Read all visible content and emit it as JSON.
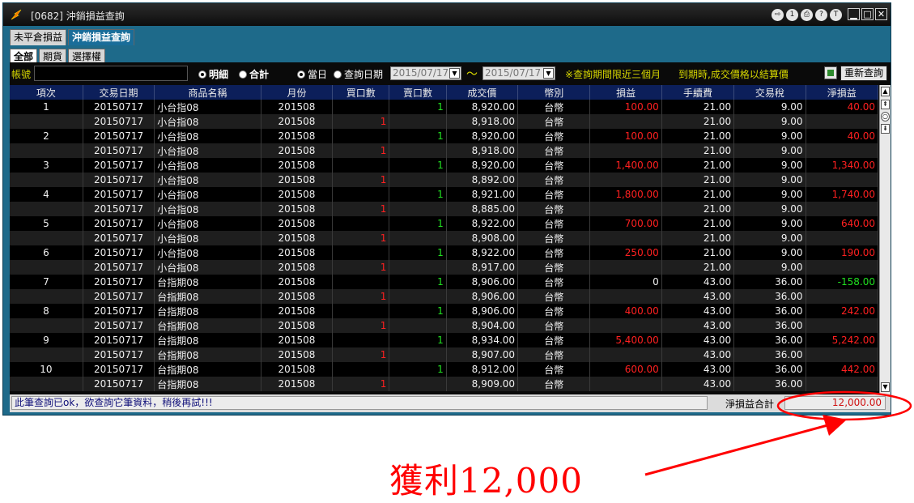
{
  "window": {
    "title": "[0682] 沖銷損益查詢",
    "toolbar_icons": [
      {
        "name": "exit-icon",
        "glyph": "⇨"
      },
      {
        "name": "info-icon",
        "glyph": "1"
      },
      {
        "name": "print-icon",
        "glyph": "⎙"
      },
      {
        "name": "help-icon",
        "glyph": "?"
      },
      {
        "name": "topmost-icon",
        "glyph": "T"
      }
    ],
    "minimize_glyph": "▁",
    "maximize_glyph": "□",
    "close_glyph": "✕"
  },
  "tabs_main": [
    {
      "label": "未平倉損益",
      "active": false
    },
    {
      "label": "沖銷損益查詢",
      "active": true
    }
  ],
  "tabs_sub": [
    {
      "label": "全部",
      "active": true
    },
    {
      "label": "期貨",
      "active": false
    },
    {
      "label": "選擇權",
      "active": false
    }
  ],
  "query": {
    "account_label": "帳號",
    "account_value": "",
    "detail_label": "明細",
    "sum_label": "合計",
    "today_label": "當日",
    "query_date_label": "查詢日期",
    "date_from": "2015/07/17",
    "tilde": "～",
    "date_to": "2015/07/17",
    "notice": "※查詢期間限近三個月",
    "notice2": "到期時,成交價格以結算價",
    "refresh_label": "重新查詢"
  },
  "table": {
    "columns": [
      "項次",
      "交易日期",
      "商品名稱",
      "月份",
      "買口數",
      "賣口數",
      "成交價",
      "幣別",
      "損益",
      "手續費",
      "交易稅",
      "淨損益"
    ],
    "rows": [
      [
        "1",
        "20150717",
        "小台指08",
        "201508",
        "",
        "1",
        "8,920.00",
        "台幣",
        "100.00",
        "21.00",
        "9.00",
        "40.00"
      ],
      [
        "",
        "20150717",
        "小台指08",
        "201508",
        "1",
        "",
        "8,918.00",
        "台幣",
        "",
        "21.00",
        "9.00",
        ""
      ],
      [
        "2",
        "20150717",
        "小台指08",
        "201508",
        "",
        "1",
        "8,920.00",
        "台幣",
        "100.00",
        "21.00",
        "9.00",
        "40.00"
      ],
      [
        "",
        "20150717",
        "小台指08",
        "201508",
        "1",
        "",
        "8,918.00",
        "台幣",
        "",
        "21.00",
        "9.00",
        ""
      ],
      [
        "3",
        "20150717",
        "小台指08",
        "201508",
        "",
        "1",
        "8,920.00",
        "台幣",
        "1,400.00",
        "21.00",
        "9.00",
        "1,340.00"
      ],
      [
        "",
        "20150717",
        "小台指08",
        "201508",
        "1",
        "",
        "8,892.00",
        "台幣",
        "",
        "21.00",
        "9.00",
        ""
      ],
      [
        "4",
        "20150717",
        "小台指08",
        "201508",
        "",
        "1",
        "8,921.00",
        "台幣",
        "1,800.00",
        "21.00",
        "9.00",
        "1,740.00"
      ],
      [
        "",
        "20150717",
        "小台指08",
        "201508",
        "1",
        "",
        "8,885.00",
        "台幣",
        "",
        "21.00",
        "9.00",
        ""
      ],
      [
        "5",
        "20150717",
        "小台指08",
        "201508",
        "",
        "1",
        "8,922.00",
        "台幣",
        "700.00",
        "21.00",
        "9.00",
        "640.00"
      ],
      [
        "",
        "20150717",
        "小台指08",
        "201508",
        "1",
        "",
        "8,908.00",
        "台幣",
        "",
        "21.00",
        "9.00",
        ""
      ],
      [
        "6",
        "20150717",
        "小台指08",
        "201508",
        "",
        "1",
        "8,922.00",
        "台幣",
        "250.00",
        "21.00",
        "9.00",
        "190.00"
      ],
      [
        "",
        "20150717",
        "小台指08",
        "201508",
        "1",
        "",
        "8,917.00",
        "台幣",
        "",
        "21.00",
        "9.00",
        ""
      ],
      [
        "7",
        "20150717",
        "台指期08",
        "201508",
        "",
        "1",
        "8,906.00",
        "台幣",
        "0",
        "43.00",
        "36.00",
        "-158.00"
      ],
      [
        "",
        "20150717",
        "台指期08",
        "201508",
        "1",
        "",
        "8,906.00",
        "台幣",
        "",
        "43.00",
        "36.00",
        ""
      ],
      [
        "8",
        "20150717",
        "台指期08",
        "201508",
        "",
        "1",
        "8,906.00",
        "台幣",
        "400.00",
        "43.00",
        "36.00",
        "242.00"
      ],
      [
        "",
        "20150717",
        "台指期08",
        "201508",
        "1",
        "",
        "8,904.00",
        "台幣",
        "",
        "43.00",
        "36.00",
        ""
      ],
      [
        "9",
        "20150717",
        "台指期08",
        "201508",
        "",
        "1",
        "8,934.00",
        "台幣",
        "5,400.00",
        "43.00",
        "36.00",
        "5,242.00"
      ],
      [
        "",
        "20150717",
        "台指期08",
        "201508",
        "1",
        "",
        "8,907.00",
        "台幣",
        "",
        "43.00",
        "36.00",
        ""
      ],
      [
        "10",
        "20150717",
        "台指期08",
        "201508",
        "",
        "1",
        "8,912.00",
        "台幣",
        "600.00",
        "43.00",
        "36.00",
        "442.00"
      ],
      [
        "",
        "20150717",
        "台指期08",
        "201508",
        "1",
        "",
        "8,909.00",
        "台幣",
        "",
        "43.00",
        "36.00",
        ""
      ]
    ]
  },
  "scrollbar": {
    "up": "▲",
    "top": "⇞",
    "mid": "○",
    "down_page": "⇟",
    "down": "▼"
  },
  "status": {
    "message": "此筆查詢已ok，欲查詢它筆資料，稍後再試!!!",
    "total_label": "淨損益合計",
    "total_value": "12,000.00"
  },
  "annotation": {
    "caption": "獲利12,000",
    "color": "#ff0000"
  },
  "colors": {
    "profit": "#ff2020",
    "loss": "#20e020",
    "header_bg": "#0c1f5a",
    "accent": "#d8d800"
  }
}
